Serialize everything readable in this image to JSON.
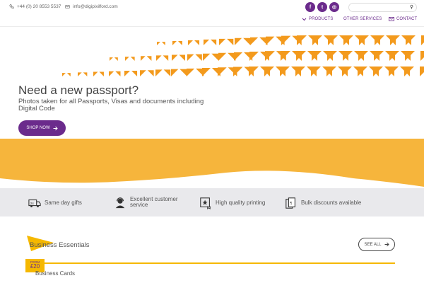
{
  "topbar": {
    "phone": "+44 (0) 20 8553 5537",
    "email": "info@digipixilford.com",
    "social": [
      {
        "name": "facebook",
        "glyph": "f"
      },
      {
        "name": "twitter",
        "glyph": "t"
      },
      {
        "name": "instagram",
        "glyph": "◎"
      }
    ],
    "search_placeholder": ""
  },
  "nav": {
    "products": "PRODUCTS",
    "other_services": "OTHER SERVICES",
    "contact": "CONTACT"
  },
  "hero": {
    "title": "Need a new passport?",
    "subtitle": "Photos taken for all Passports, Visas and documents including Digital Code",
    "button": "SHOP NOW"
  },
  "features": [
    {
      "label": "Same day gifts",
      "icon": "van-24-icon"
    },
    {
      "label": "Excellent customer service",
      "icon": "headset-icon"
    },
    {
      "label": "High quality printing",
      "icon": "certificate-icon"
    },
    {
      "label": "Bulk discounts available",
      "icon": "layers-icon"
    }
  ],
  "business_essentials": {
    "title": "Business Essentials",
    "see_all": "SEE ALL",
    "price_from": "FROM",
    "price": "£20",
    "first_item": "Business Cards",
    "second_item": ""
  },
  "colors": {
    "purple": "#6b2b8c",
    "orange": "#f39a1d",
    "yellow": "#f5b800",
    "wave": "#f6b53c"
  }
}
